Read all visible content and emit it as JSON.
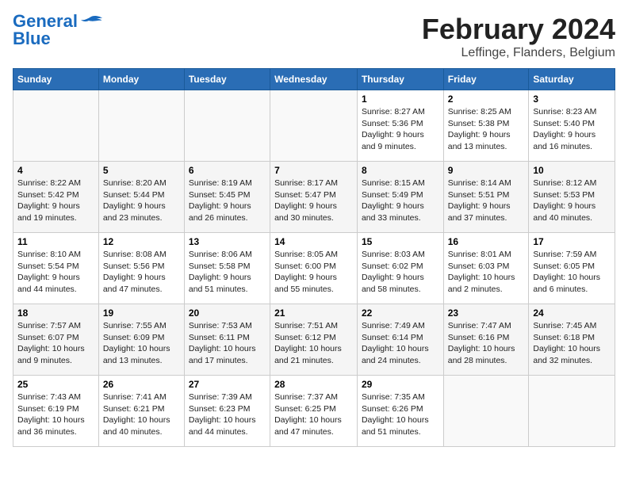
{
  "header": {
    "logo_line1": "General",
    "logo_line2": "Blue",
    "title": "February 2024",
    "location": "Leffinge, Flanders, Belgium"
  },
  "days_of_week": [
    "Sunday",
    "Monday",
    "Tuesday",
    "Wednesday",
    "Thursday",
    "Friday",
    "Saturday"
  ],
  "weeks": [
    [
      {
        "day": "",
        "info": ""
      },
      {
        "day": "",
        "info": ""
      },
      {
        "day": "",
        "info": ""
      },
      {
        "day": "",
        "info": ""
      },
      {
        "day": "1",
        "info": "Sunrise: 8:27 AM\nSunset: 5:36 PM\nDaylight: 9 hours\nand 9 minutes."
      },
      {
        "day": "2",
        "info": "Sunrise: 8:25 AM\nSunset: 5:38 PM\nDaylight: 9 hours\nand 13 minutes."
      },
      {
        "day": "3",
        "info": "Sunrise: 8:23 AM\nSunset: 5:40 PM\nDaylight: 9 hours\nand 16 minutes."
      }
    ],
    [
      {
        "day": "4",
        "info": "Sunrise: 8:22 AM\nSunset: 5:42 PM\nDaylight: 9 hours\nand 19 minutes."
      },
      {
        "day": "5",
        "info": "Sunrise: 8:20 AM\nSunset: 5:44 PM\nDaylight: 9 hours\nand 23 minutes."
      },
      {
        "day": "6",
        "info": "Sunrise: 8:19 AM\nSunset: 5:45 PM\nDaylight: 9 hours\nand 26 minutes."
      },
      {
        "day": "7",
        "info": "Sunrise: 8:17 AM\nSunset: 5:47 PM\nDaylight: 9 hours\nand 30 minutes."
      },
      {
        "day": "8",
        "info": "Sunrise: 8:15 AM\nSunset: 5:49 PM\nDaylight: 9 hours\nand 33 minutes."
      },
      {
        "day": "9",
        "info": "Sunrise: 8:14 AM\nSunset: 5:51 PM\nDaylight: 9 hours\nand 37 minutes."
      },
      {
        "day": "10",
        "info": "Sunrise: 8:12 AM\nSunset: 5:53 PM\nDaylight: 9 hours\nand 40 minutes."
      }
    ],
    [
      {
        "day": "11",
        "info": "Sunrise: 8:10 AM\nSunset: 5:54 PM\nDaylight: 9 hours\nand 44 minutes."
      },
      {
        "day": "12",
        "info": "Sunrise: 8:08 AM\nSunset: 5:56 PM\nDaylight: 9 hours\nand 47 minutes."
      },
      {
        "day": "13",
        "info": "Sunrise: 8:06 AM\nSunset: 5:58 PM\nDaylight: 9 hours\nand 51 minutes."
      },
      {
        "day": "14",
        "info": "Sunrise: 8:05 AM\nSunset: 6:00 PM\nDaylight: 9 hours\nand 55 minutes."
      },
      {
        "day": "15",
        "info": "Sunrise: 8:03 AM\nSunset: 6:02 PM\nDaylight: 9 hours\nand 58 minutes."
      },
      {
        "day": "16",
        "info": "Sunrise: 8:01 AM\nSunset: 6:03 PM\nDaylight: 10 hours\nand 2 minutes."
      },
      {
        "day": "17",
        "info": "Sunrise: 7:59 AM\nSunset: 6:05 PM\nDaylight: 10 hours\nand 6 minutes."
      }
    ],
    [
      {
        "day": "18",
        "info": "Sunrise: 7:57 AM\nSunset: 6:07 PM\nDaylight: 10 hours\nand 9 minutes."
      },
      {
        "day": "19",
        "info": "Sunrise: 7:55 AM\nSunset: 6:09 PM\nDaylight: 10 hours\nand 13 minutes."
      },
      {
        "day": "20",
        "info": "Sunrise: 7:53 AM\nSunset: 6:11 PM\nDaylight: 10 hours\nand 17 minutes."
      },
      {
        "day": "21",
        "info": "Sunrise: 7:51 AM\nSunset: 6:12 PM\nDaylight: 10 hours\nand 21 minutes."
      },
      {
        "day": "22",
        "info": "Sunrise: 7:49 AM\nSunset: 6:14 PM\nDaylight: 10 hours\nand 24 minutes."
      },
      {
        "day": "23",
        "info": "Sunrise: 7:47 AM\nSunset: 6:16 PM\nDaylight: 10 hours\nand 28 minutes."
      },
      {
        "day": "24",
        "info": "Sunrise: 7:45 AM\nSunset: 6:18 PM\nDaylight: 10 hours\nand 32 minutes."
      }
    ],
    [
      {
        "day": "25",
        "info": "Sunrise: 7:43 AM\nSunset: 6:19 PM\nDaylight: 10 hours\nand 36 minutes."
      },
      {
        "day": "26",
        "info": "Sunrise: 7:41 AM\nSunset: 6:21 PM\nDaylight: 10 hours\nand 40 minutes."
      },
      {
        "day": "27",
        "info": "Sunrise: 7:39 AM\nSunset: 6:23 PM\nDaylight: 10 hours\nand 44 minutes."
      },
      {
        "day": "28",
        "info": "Sunrise: 7:37 AM\nSunset: 6:25 PM\nDaylight: 10 hours\nand 47 minutes."
      },
      {
        "day": "29",
        "info": "Sunrise: 7:35 AM\nSunset: 6:26 PM\nDaylight: 10 hours\nand 51 minutes."
      },
      {
        "day": "",
        "info": ""
      },
      {
        "day": "",
        "info": ""
      }
    ]
  ]
}
